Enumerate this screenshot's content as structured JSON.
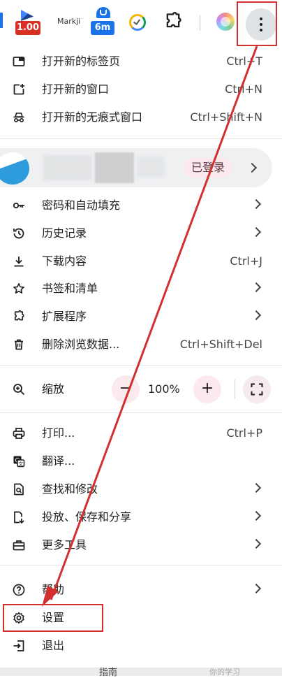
{
  "toolbar": {
    "speed_badge": "1.00",
    "markji_label": "Markji",
    "timer_badge": "6m"
  },
  "menu": {
    "new_tab": {
      "label": "打开新的标签页",
      "shortcut": "Ctrl+T"
    },
    "new_window": {
      "label": "打开新的窗口",
      "shortcut": "Ctrl+N"
    },
    "incognito": {
      "label": "打开新的无痕式窗口",
      "shortcut": "Ctrl+Shift+N"
    },
    "profile": {
      "status": "已登录"
    },
    "passwords": {
      "label": "密码和自动填充"
    },
    "history": {
      "label": "历史记录"
    },
    "downloads": {
      "label": "下载内容",
      "shortcut": "Ctrl+J"
    },
    "bookmarks": {
      "label": "书签和清单"
    },
    "extensions": {
      "label": "扩展程序"
    },
    "clear_data": {
      "label": "删除浏览数据...",
      "shortcut": "Ctrl+Shift+Del"
    },
    "zoom": {
      "label": "缩放",
      "minus": "−",
      "value": "100%",
      "plus": "+"
    },
    "print": {
      "label": "打印...",
      "shortcut": "Ctrl+P"
    },
    "translate": {
      "label": "翻译..."
    },
    "find_edit": {
      "label": "查找和修改"
    },
    "cast_save_share": {
      "label": "投放、保存和分享"
    },
    "more_tools": {
      "label": "更多工具"
    },
    "help": {
      "label": "帮助"
    },
    "settings": {
      "label": "设置"
    },
    "exit": {
      "label": "退出"
    }
  },
  "bottom": {
    "tab_text": "指南",
    "watermark": "你的学习"
  },
  "colors": {
    "annotation": "#d32f2f",
    "accent_pink": "#fbe9ee"
  }
}
